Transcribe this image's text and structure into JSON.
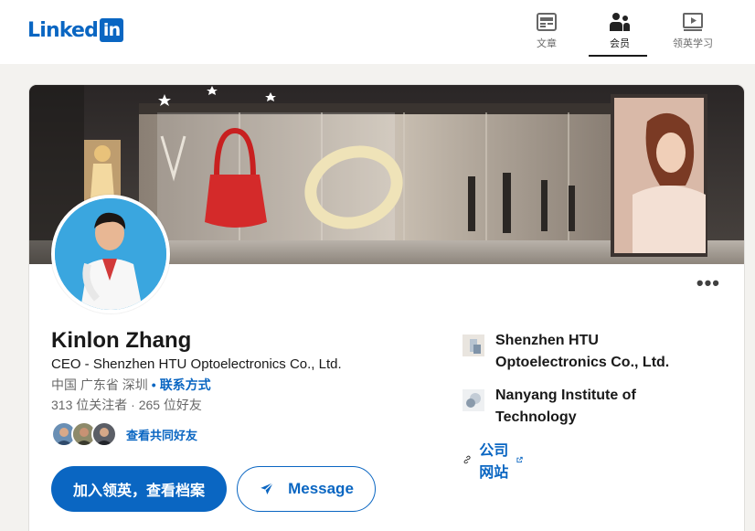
{
  "brand": {
    "wordmark": "Linked",
    "box": "in",
    "color": "#0a66c2"
  },
  "nav": [
    {
      "label": "文章",
      "icon": "articles-icon"
    },
    {
      "label": "会员",
      "icon": "people-icon",
      "active": true
    },
    {
      "label": "领英学习",
      "icon": "learning-icon"
    }
  ],
  "profile": {
    "name": "Kinlon Zhang",
    "headline": "CEO - Shenzhen HTU Optoelectronics Co., Ltd.",
    "location": "中国 广东省 深圳",
    "contact_label": "联系方式",
    "stats": "313 位关注者 · 265 位好友",
    "mutual_label": "查看共同好友",
    "more_label": "•••"
  },
  "actions": {
    "join_label": "加入领英，查看档案",
    "message_label": "Message"
  },
  "sidebar": {
    "company": "Shenzhen HTU Optoelectronics Co., Ltd.",
    "company_line1": "Shenzhen HTU",
    "company_line2": "Optoelectronics Co., Ltd.",
    "school_line1": "Nanyang Institute of",
    "school_line2": "Technology",
    "website_label": "公司网站"
  },
  "icons": [
    "articles-icon",
    "people-icon",
    "learning-icon",
    "send-icon",
    "link-icon",
    "external-link-icon",
    "company-logo-icon",
    "school-logo-icon",
    "more-icon"
  ]
}
